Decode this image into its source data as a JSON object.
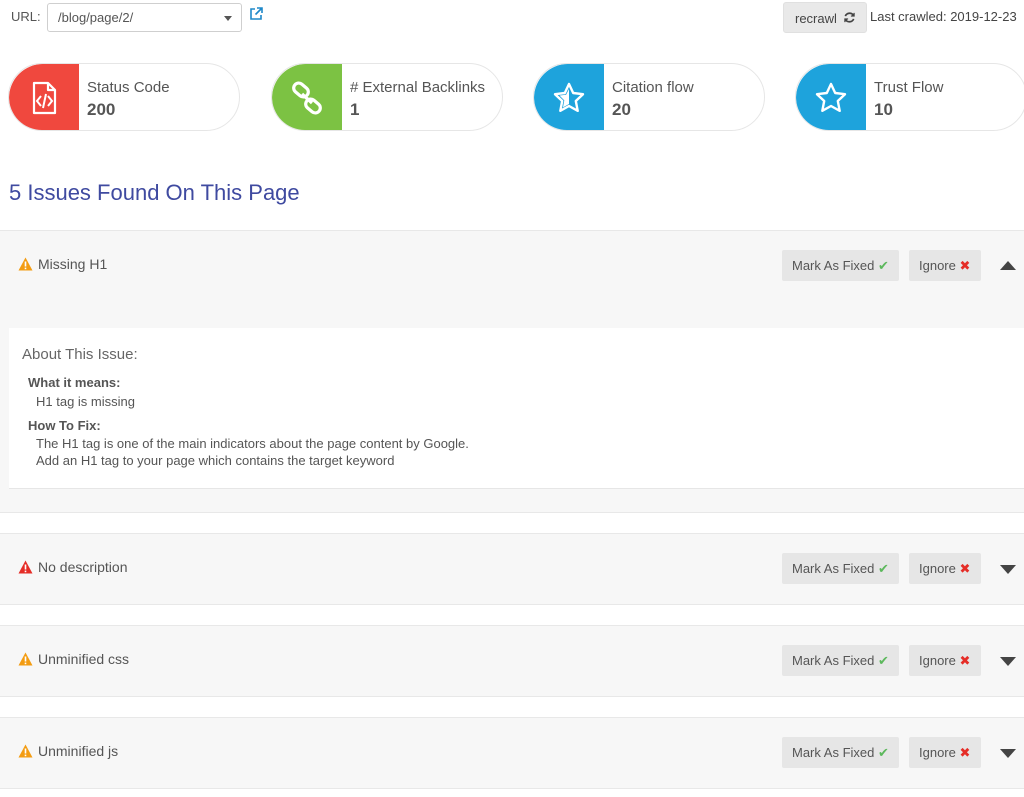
{
  "topbar": {
    "url_label": "URL:",
    "url_value": "/blog/page/2/",
    "recrawl_label": "recrawl",
    "last_crawled": "Last crawled: 2019-12-23"
  },
  "cards": [
    {
      "title": "Status Code",
      "value": "200",
      "icon": "code-file-icon",
      "color": "#f0483e"
    },
    {
      "title": "# External Backlinks",
      "value": "1",
      "icon": "link-icon",
      "color": "#7cc243"
    },
    {
      "title": "Citation flow",
      "value": "20",
      "icon": "star-icon",
      "color": "#1ea3dc"
    },
    {
      "title": "Trust Flow",
      "value": "10",
      "icon": "star-icon",
      "color": "#1ea3dc"
    }
  ],
  "issues_heading": "5 Issues Found On This Page",
  "buttons": {
    "mark_fixed": "Mark As Fixed",
    "ignore": "Ignore"
  },
  "issues": [
    {
      "name": "Missing H1",
      "severity": "warning",
      "expanded": true
    },
    {
      "name": "No description",
      "severity": "error",
      "expanded": false
    },
    {
      "name": "Unminified css",
      "severity": "warning",
      "expanded": false
    },
    {
      "name": "Unminified js",
      "severity": "warning",
      "expanded": false
    }
  ],
  "detail": {
    "about": "About This Issue:",
    "what_heading": "What it means:",
    "what_text": "H1 tag is missing",
    "how_heading": "How To Fix:",
    "how_line1": "The H1 tag is one of the main indicators about the page content by Google.",
    "how_line2": "Add an H1 tag to your page which contains the target keyword"
  },
  "colors": {
    "warning": "#f39c12",
    "error": "#e52d27",
    "check": "#5cb85c",
    "cross": "#e52d27",
    "heading": "#3f4aa0"
  }
}
